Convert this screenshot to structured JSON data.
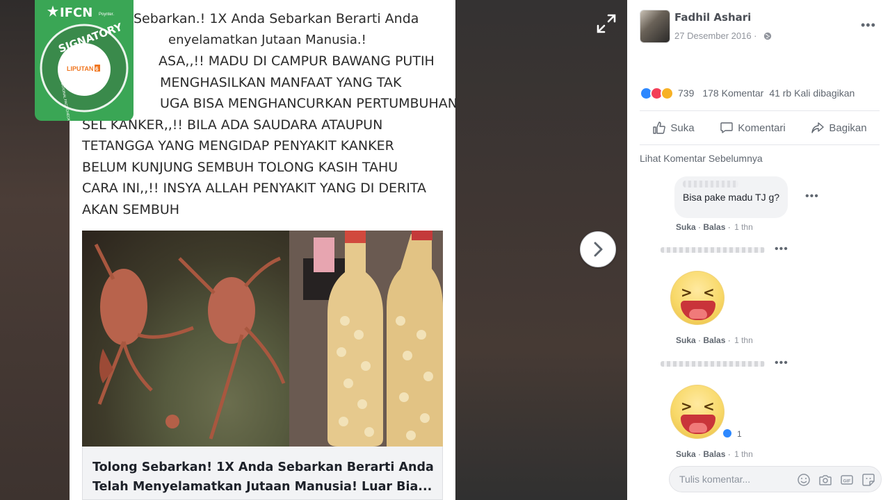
{
  "post": {
    "text_lines": [
      "Sebarkan.! 1X Anda Sebarkan Berarti Anda",
      "enyelamatkan Jutaan Manusia.!",
      "ASA,,!! MADU DI CAMPUR BAWANG PUTIH",
      "MENGHASILKAN MANFAAT YANG TAK",
      "UGA BISA MENGHANCURKAN PERTUMBUHAN",
      "SEL KANKER,,!! BILA ADA SAUDARA ATAUPUN",
      "TETANGGA YANG MENGIDAP PENYAKIT KANKER",
      "BELUM KUNJUNG SEMBUH TOLONG KASIH TAHU",
      "CARA INI,,!! INSYA ALLAH PENYAKIT YANG DI DERITA",
      "AKAN SEMBUH"
    ],
    "link_title_lines": [
      "Tolong Sebarkan! 1X Anda Sebarkan Berarti Anda",
      "Telah Menyelamatkan Jutaan Manusia! Luar Bia..."
    ]
  },
  "badge": {
    "logo": "IFCN",
    "poynter": "Poynter.",
    "signatory": "SIGNATORY",
    "network": "INTERNATIONAL FACT-CHECKING NETWORK",
    "member": "LIPUTAN6"
  },
  "icons": {
    "expand": "expand-icon",
    "next": "chevron-right-icon",
    "globe": "globe-icon",
    "more": "more-horizontal-icon"
  },
  "author": {
    "name": "Fadhil Ashari",
    "date": "27 Desember 2016 ·"
  },
  "stats": {
    "reaction_count": "739",
    "comments": "178 Komentar",
    "shares": "41 rb Kali dibagikan"
  },
  "actions": {
    "like": "Suka",
    "comment": "Komentari",
    "share": "Bagikan"
  },
  "prev_comments": "Lihat Komentar Sebelumnya",
  "comments": [
    {
      "text": "Bisa pake madu TJ g?",
      "like": "Suka",
      "reply": "Balas",
      "time": "1 thn"
    },
    {
      "text": "",
      "like": "Suka",
      "reply": "Balas",
      "time": "1 thn"
    },
    {
      "text": "",
      "like": "Suka",
      "reply": "Balas",
      "time": "1 thn",
      "reaction_count": "1"
    }
  ],
  "composer": {
    "placeholder": "Tulis komentar..."
  },
  "colors": {
    "ifcn_green": "#3aa655",
    "fb_blue": "#2d88ff",
    "love_red": "#f33e58",
    "haha_yellow": "#f7b125"
  }
}
